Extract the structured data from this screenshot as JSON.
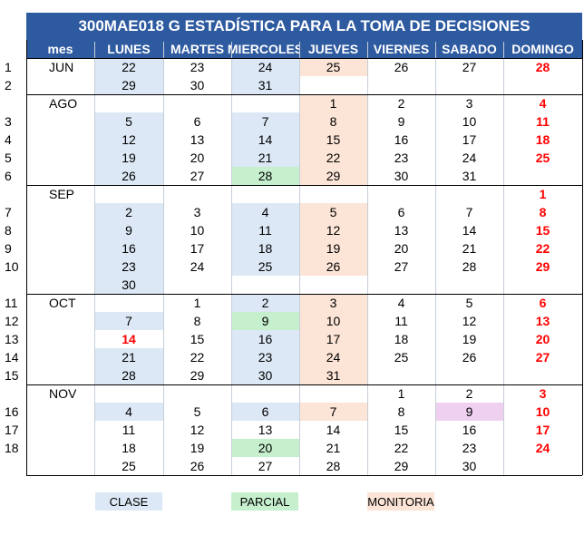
{
  "title": "300MAE018 G     ESTADÍSTICA PARA LA TOMA DE DECISIONES",
  "headers": [
    "mes",
    "LUNES",
    "MARTES",
    "MIERCOLES",
    "JUEVES",
    "VIERNES",
    "SABADO",
    "DOMINGO"
  ],
  "colors": {
    "clase": "#dce8f5",
    "parcial": "#c6efce",
    "monitoria": "#fce4d6",
    "special": "#f0d0f0",
    "header": "#2e5aa0",
    "sunday": "#ff0000"
  },
  "rows": [
    {
      "wk": "1",
      "mon": "JUN",
      "d": [
        "22",
        "23",
        "24",
        "25",
        "26",
        "27",
        "28"
      ],
      "bg": [
        "c",
        "",
        "c",
        "m",
        "",
        "",
        ""
      ]
    },
    {
      "wk": "2",
      "mon": "",
      "d": [
        "29",
        "30",
        "31",
        "",
        "",
        "",
        ""
      ],
      "bg": [
        "c",
        "",
        "c",
        "",
        "",
        "",
        ""
      ]
    },
    {
      "wk": "",
      "mon": "AGO",
      "d": [
        "",
        "",
        "",
        "1",
        "2",
        "3",
        "4"
      ],
      "bg": [
        "",
        "",
        "",
        "m",
        "",
        "",
        ""
      ]
    },
    {
      "wk": "3",
      "mon": "",
      "d": [
        "5",
        "6",
        "7",
        "8",
        "9",
        "10",
        "11"
      ],
      "bg": [
        "c",
        "",
        "c",
        "m",
        "",
        "",
        ""
      ]
    },
    {
      "wk": "4",
      "mon": "",
      "d": [
        "12",
        "13",
        "14",
        "15",
        "16",
        "17",
        "18"
      ],
      "bg": [
        "c",
        "",
        "c",
        "m",
        "",
        "",
        ""
      ]
    },
    {
      "wk": "5",
      "mon": "",
      "d": [
        "19",
        "20",
        "21",
        "22",
        "23",
        "24",
        "25"
      ],
      "bg": [
        "c",
        "",
        "c",
        "m",
        "",
        "",
        ""
      ]
    },
    {
      "wk": "6",
      "mon": "",
      "d": [
        "26",
        "27",
        "28",
        "29",
        "30",
        "31",
        ""
      ],
      "bg": [
        "c",
        "",
        "p",
        "m",
        "",
        "",
        ""
      ]
    },
    {
      "wk": "",
      "mon": "SEP",
      "d": [
        "",
        "",
        "",
        "",
        "",
        "",
        "1"
      ],
      "bg": [
        "",
        "",
        "",
        "",
        "",
        "",
        ""
      ]
    },
    {
      "wk": "7",
      "mon": "",
      "d": [
        "2",
        "3",
        "4",
        "5",
        "6",
        "7",
        "8"
      ],
      "bg": [
        "c",
        "",
        "c",
        "m",
        "",
        "",
        ""
      ]
    },
    {
      "wk": "8",
      "mon": "",
      "d": [
        "9",
        "10",
        "11",
        "12",
        "13",
        "14",
        "15"
      ],
      "bg": [
        "c",
        "",
        "c",
        "m",
        "",
        "",
        ""
      ]
    },
    {
      "wk": "9",
      "mon": "",
      "d": [
        "16",
        "17",
        "18",
        "19",
        "20",
        "21",
        "22"
      ],
      "bg": [
        "c",
        "",
        "c",
        "m",
        "",
        "",
        ""
      ]
    },
    {
      "wk": "10",
      "mon": "",
      "d": [
        "23",
        "24",
        "25",
        "26",
        "27",
        "28",
        "29"
      ],
      "bg": [
        "c",
        "",
        "c",
        "m",
        "",
        "",
        ""
      ]
    },
    {
      "wk": "",
      "mon": "",
      "d": [
        "30",
        "",
        "",
        "",
        "",
        "",
        ""
      ],
      "bg": [
        "c",
        "",
        "",
        "",
        "",
        "",
        ""
      ]
    },
    {
      "wk": "11",
      "mon": "OCT",
      "d": [
        "",
        "1",
        "2",
        "3",
        "4",
        "5",
        "6"
      ],
      "bg": [
        "",
        "",
        "c",
        "m",
        "",
        "",
        ""
      ]
    },
    {
      "wk": "12",
      "mon": "",
      "d": [
        "7",
        "8",
        "9",
        "10",
        "11",
        "12",
        "13"
      ],
      "bg": [
        "c",
        "",
        "p",
        "m",
        "",
        "",
        ""
      ]
    },
    {
      "wk": "13",
      "mon": "",
      "d": [
        "14",
        "15",
        "16",
        "17",
        "18",
        "19",
        "20"
      ],
      "bg": [
        "",
        "",
        "c",
        "m",
        "",
        "",
        ""
      ],
      "red": [
        0
      ]
    },
    {
      "wk": "14",
      "mon": "",
      "d": [
        "21",
        "22",
        "23",
        "24",
        "25",
        "26",
        "27"
      ],
      "bg": [
        "c",
        "",
        "c",
        "m",
        "",
        "",
        ""
      ]
    },
    {
      "wk": "15",
      "mon": "",
      "d": [
        "28",
        "29",
        "30",
        "31",
        "",
        "",
        ""
      ],
      "bg": [
        "c",
        "",
        "c",
        "m",
        "",
        "",
        ""
      ]
    },
    {
      "wk": "",
      "mon": "NOV",
      "d": [
        "",
        "",
        "",
        "",
        "1",
        "2",
        "3"
      ],
      "bg": [
        "",
        "",
        "",
        "",
        "",
        "",
        ""
      ]
    },
    {
      "wk": "16",
      "mon": "",
      "d": [
        "4",
        "5",
        "6",
        "7",
        "8",
        "9",
        "10"
      ],
      "bg": [
        "c",
        "",
        "c",
        "m",
        "",
        "s",
        ""
      ]
    },
    {
      "wk": "17",
      "mon": "",
      "d": [
        "11",
        "12",
        "13",
        "14",
        "15",
        "16",
        "17"
      ],
      "bg": [
        "",
        "",
        "",
        "",
        "",
        "",
        ""
      ]
    },
    {
      "wk": "18",
      "mon": "",
      "d": [
        "18",
        "19",
        "20",
        "21",
        "22",
        "23",
        "24"
      ],
      "bg": [
        "",
        "",
        "p",
        "",
        "",
        "",
        ""
      ]
    },
    {
      "wk": "",
      "mon": "",
      "d": [
        "25",
        "26",
        "27",
        "28",
        "29",
        "30",
        ""
      ],
      "bg": [
        "",
        "",
        "",
        "",
        "",
        "",
        ""
      ]
    }
  ],
  "legend": {
    "clase": "CLASE",
    "parcial": "PARCIAL",
    "monitoria": "MONITORIA"
  }
}
